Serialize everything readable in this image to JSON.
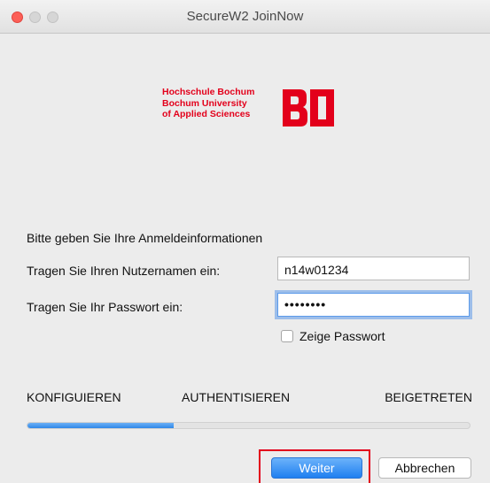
{
  "window": {
    "title": "SecureW2 JoinNow"
  },
  "logo": {
    "line1": "Hochschule Bochum",
    "line2": "Bochum University",
    "line3": "of Applied Sciences",
    "mark": "BO"
  },
  "form": {
    "prompt": "Bitte geben Sie Ihre Anmeldeinformationen",
    "username_label": "Tragen Sie Ihren Nutzernamen ein:",
    "username_value": "n14w01234",
    "password_label": "Tragen Sie Ihr Passwort ein:",
    "password_value": "••••••••",
    "show_password_label": "Zeige Passwort",
    "show_password_checked": false
  },
  "steps": [
    "KONFIGUIEREN",
    "AUTHENTISIEREN",
    "BEIGETRETEN"
  ],
  "progress": {
    "fraction": 0.33
  },
  "buttons": {
    "next": "Weiter",
    "cancel": "Abbrechen"
  },
  "colors": {
    "brand_red": "#e3001b",
    "accent_blue": "#2f86e8"
  }
}
